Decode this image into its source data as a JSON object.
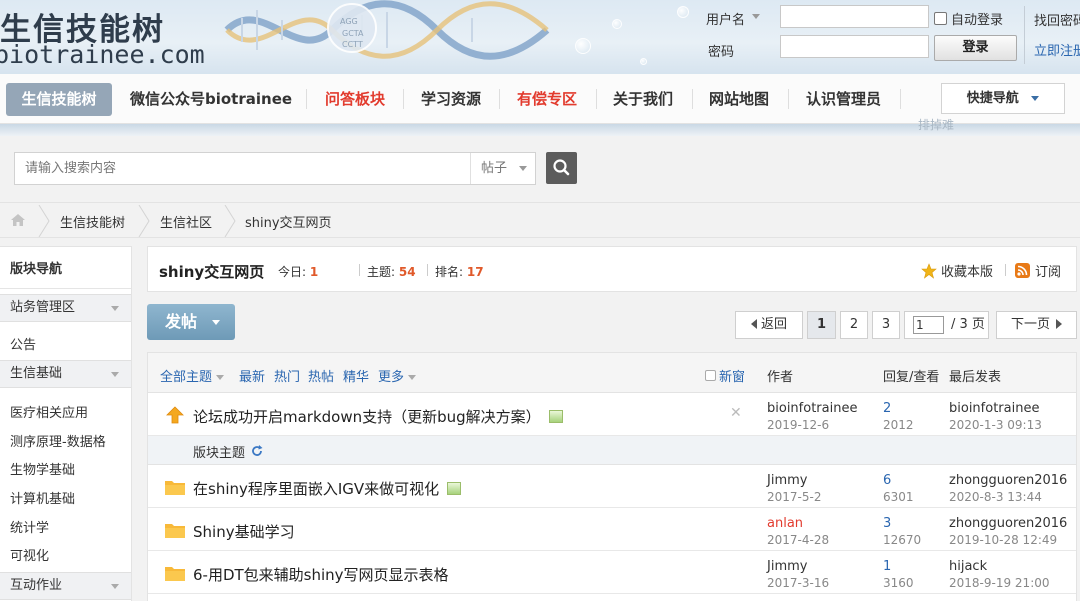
{
  "header": {
    "logo_cn": "生信技能树",
    "logo_en": "biotrainee.com",
    "username_label": "用户名",
    "password_label": "密码",
    "remember_label": "自动登录",
    "forgot_label": "找回密码",
    "login_button": "登录",
    "register_label": "立即注册"
  },
  "nav": {
    "items": [
      "生信技能树",
      "微信公众号biotrainee",
      "问答板块",
      "学习资源",
      "有偿专区",
      "关于我们",
      "网站地图",
      "认识管理员"
    ],
    "quick_nav": "快捷导航",
    "ghost_text": "排掉难"
  },
  "search": {
    "placeholder": "请输入搜索内容",
    "type": "帖子"
  },
  "breadcrumb": [
    "生信技能树",
    "生信社区",
    "shiny交互网页"
  ],
  "sidebar": {
    "title": "版块导航",
    "groups": [
      {
        "label": "站务管理区",
        "items": [
          "公告"
        ]
      },
      {
        "label": "生信基础",
        "items": [
          "医疗相关应用",
          "测序原理-数据格",
          "生物学基础",
          "计算机基础",
          "统计学",
          "可视化"
        ]
      },
      {
        "label": "互动作业",
        "items": []
      }
    ]
  },
  "forum": {
    "title": "shiny交互网页",
    "today_label": "今日:",
    "today": "1",
    "topics_label": "主题:",
    "topics": "54",
    "rank_label": "排名:",
    "rank": "17",
    "favorite": "收藏本版",
    "subscribe": "订阅",
    "post_button": "发帖"
  },
  "pagination": {
    "back": "返回",
    "pages": [
      "1",
      "2",
      "3"
    ],
    "current": "1",
    "total": "/ 3 页",
    "next": "下一页"
  },
  "list": {
    "filters": [
      "全部主题",
      "最新",
      "热门",
      "热帖",
      "精华",
      "更多"
    ],
    "new_window": "新窗",
    "columns": {
      "author": "作者",
      "reply_view": "回复/查看",
      "last_post": "最后发表"
    },
    "section_label": "版块主题",
    "sticky": {
      "title": "论坛成功开启markdown支持（更新bug解决方案）",
      "author": "bioinfotrainee",
      "date": "2019-12-6",
      "replies": "2",
      "views": "2012",
      "last_user": "bioinfotrainee",
      "last_date": "2020-1-3 09:13"
    },
    "rows": [
      {
        "title": "在shiny程序里面嵌入IGV来做可视化",
        "author": "Jimmy",
        "date": "2017-5-2",
        "replies": "6",
        "views": "6301",
        "last_user": "zhongguoren2016",
        "last_date": "2020-8-3 13:44"
      },
      {
        "title": "Shiny基础学习",
        "author": "anlan",
        "date": "2017-4-28",
        "replies": "3",
        "views": "12670",
        "last_user": "zhongguoren2016",
        "last_date": "2019-10-28 12:49"
      },
      {
        "title": "6-用DT包来辅助shiny写网页显示表格",
        "author": "Jimmy",
        "date": "2017-3-16",
        "replies": "1",
        "views": "3160",
        "last_user": "hijack",
        "last_date": "2018-9-19 21:00"
      }
    ]
  },
  "colors": {
    "accent_blue": "#2a66b0",
    "accent_red": "#e23b2e",
    "number_orange": "#e0592a",
    "nav_active": "#95a6b7"
  }
}
